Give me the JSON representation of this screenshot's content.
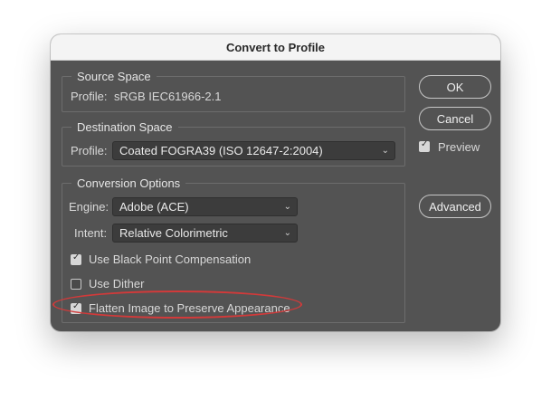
{
  "dialog": {
    "title": "Convert to Profile"
  },
  "source_space": {
    "legend": "Source Space",
    "profile_label": "Profile:",
    "profile_value": "sRGB IEC61966-2.1"
  },
  "destination_space": {
    "legend": "Destination Space",
    "profile_label": "Profile:",
    "profile_value": "Coated FOGRA39 (ISO 12647-2:2004)"
  },
  "conversion_options": {
    "legend": "Conversion Options",
    "engine_label": "Engine:",
    "engine_value": "Adobe (ACE)",
    "intent_label": "Intent:",
    "intent_value": "Relative Colorimetric",
    "black_point": {
      "label": "Use Black Point Compensation",
      "checked": true
    },
    "dither": {
      "label": "Use Dither",
      "checked": false
    },
    "flatten": {
      "label": "Flatten Image to Preserve Appearance",
      "checked": true
    }
  },
  "buttons": {
    "ok": "OK",
    "cancel": "Cancel",
    "advanced": "Advanced"
  },
  "preview": {
    "label": "Preview",
    "checked": true
  },
  "colors": {
    "dialog_bg": "#535353",
    "highlight_ring": "#d23a3a"
  }
}
